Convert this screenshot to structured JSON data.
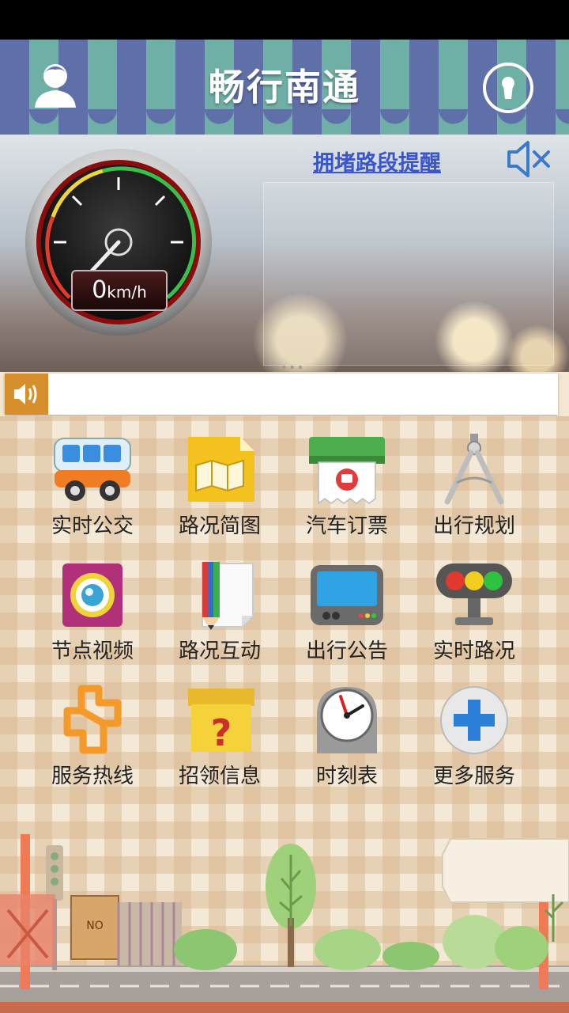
{
  "header": {
    "title": "畅行南通"
  },
  "hero": {
    "congestion_link": "拥堵路段提醒",
    "speed_value": "0",
    "speed_unit": "km/h"
  },
  "grid": {
    "items": [
      {
        "label": "实时公交",
        "icon": "bus-icon"
      },
      {
        "label": "路况简图",
        "icon": "map-icon"
      },
      {
        "label": "汽车订票",
        "icon": "ticket-icon"
      },
      {
        "label": "出行规划",
        "icon": "compass-icon"
      },
      {
        "label": "节点视频",
        "icon": "camera-icon"
      },
      {
        "label": "路况互动",
        "icon": "pencil-note-icon"
      },
      {
        "label": "出行公告",
        "icon": "display-icon"
      },
      {
        "label": "实时路况",
        "icon": "traffic-light-icon"
      },
      {
        "label": "服务热线",
        "icon": "hotline-logo-icon"
      },
      {
        "label": "招领信息",
        "icon": "question-box-icon"
      },
      {
        "label": "时刻表",
        "icon": "clock-icon"
      },
      {
        "label": "更多服务",
        "icon": "plus-icon"
      }
    ]
  },
  "scene": {
    "sign_text": "NO"
  },
  "colors": {
    "link": "#3b56c9",
    "stripe_blue": "#5f6fa8",
    "stripe_teal": "#6fb0a6",
    "ticker_accent": "#d68f2b"
  }
}
